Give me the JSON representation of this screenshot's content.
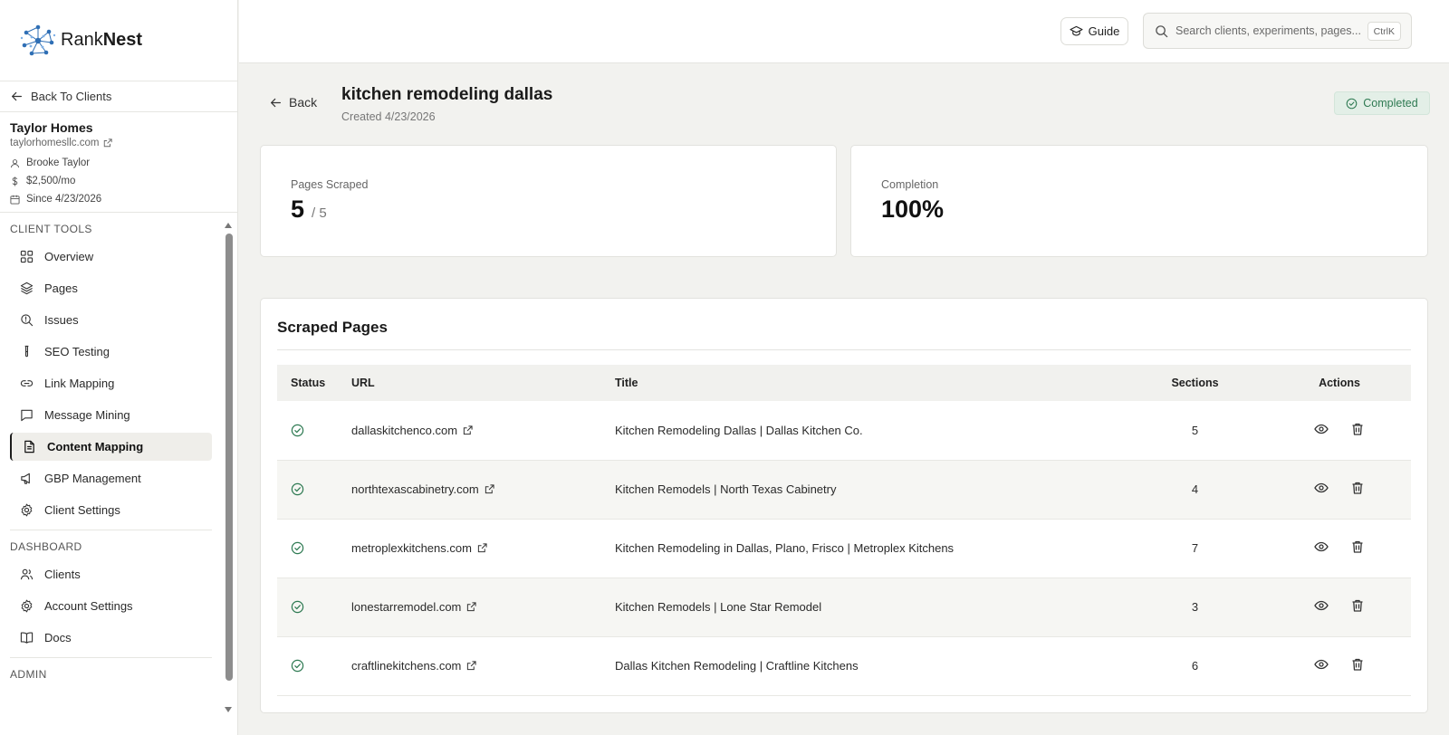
{
  "brand": {
    "name_light": "Rank",
    "name_bold": "Nest"
  },
  "sidebar": {
    "back_label": "Back To Clients",
    "client": {
      "name": "Taylor Homes",
      "domain": "taylorhomesllc.com",
      "contact": "Brooke Taylor",
      "retainer": "$2,500/mo",
      "since": "Since 4/23/2026"
    },
    "sections": [
      {
        "label": "CLIENT TOOLS",
        "items": [
          {
            "label": "Overview",
            "icon": "grid-icon"
          },
          {
            "label": "Pages",
            "icon": "layers-icon"
          },
          {
            "label": "Issues",
            "icon": "search-issue-icon"
          },
          {
            "label": "SEO Testing",
            "icon": "test-tube-icon"
          },
          {
            "label": "Link Mapping",
            "icon": "link-icon"
          },
          {
            "label": "Message Mining",
            "icon": "message-icon"
          },
          {
            "label": "Content Mapping",
            "icon": "document-icon",
            "active": true
          },
          {
            "label": "GBP Management",
            "icon": "megaphone-icon"
          },
          {
            "label": "Client Settings",
            "icon": "gear-icon"
          }
        ]
      },
      {
        "label": "DASHBOARD",
        "items": [
          {
            "label": "Clients",
            "icon": "users-icon"
          },
          {
            "label": "Account Settings",
            "icon": "gear-icon"
          },
          {
            "label": "Docs",
            "icon": "book-icon"
          }
        ]
      },
      {
        "label": "ADMIN",
        "items": []
      }
    ]
  },
  "topbar": {
    "guide_label": "Guide",
    "search_placeholder": "Search clients, experiments, pages...",
    "shortcut": "CtrlK"
  },
  "header": {
    "back_label": "Back",
    "title": "kitchen remodeling dallas",
    "created": "Created 4/23/2026",
    "status": "Completed"
  },
  "stats": {
    "pages_scraped_label": "Pages Scraped",
    "pages_scraped_value": "5",
    "pages_scraped_total": "/ 5",
    "completion_label": "Completion",
    "completion_value": "100%"
  },
  "table": {
    "title": "Scraped Pages",
    "columns": [
      "Status",
      "URL",
      "Title",
      "Sections",
      "Actions"
    ],
    "rows": [
      {
        "url": "dallaskitchenco.com",
        "title": "Kitchen Remodeling Dallas | Dallas Kitchen Co.",
        "sections": "5"
      },
      {
        "url": "northtexascabinetry.com",
        "title": "Kitchen Remodels | North Texas Cabinetry",
        "sections": "4"
      },
      {
        "url": "metroplexkitchens.com",
        "title": "Kitchen Remodeling in Dallas, Plano, Frisco | Metroplex Kitchens",
        "sections": "7"
      },
      {
        "url": "lonestarremodel.com",
        "title": "Kitchen Remodels | Lone Star Remodel",
        "sections": "3"
      },
      {
        "url": "craftlinekitchens.com",
        "title": "Dallas Kitchen Remodeling | Craftline Kitchens",
        "sections": "6"
      }
    ]
  },
  "colors": {
    "accent_green": "#2e7a52",
    "badge_bg": "#e3efe7",
    "brand_blue": "#2f6fb5"
  }
}
